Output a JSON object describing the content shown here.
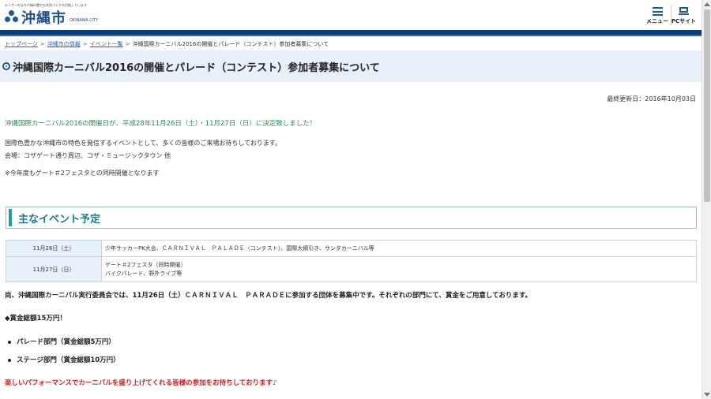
{
  "header": {
    "tagline": "エイサーのまちや緑の豊かな共同づくりを目指しています",
    "logo_name": "沖縄市",
    "logo_en": "OKINAWA CITY",
    "menu_label": "メニュー",
    "pc_label": "PCサイト"
  },
  "breadcrumb": {
    "items": [
      "トップページ",
      "沖縄市の情報",
      "イベント一覧"
    ],
    "current": "沖縄国際カーニバル2016の開催とパレード（コンテスト）参加者募集について",
    "separator": ">"
  },
  "page": {
    "title": "沖縄国際カーニバル2016の開催とパレード（コンテスト）参加者募集について",
    "updated": "最終更新日：2016年10月03日",
    "lead": "沖縄国際カーニバル2016の開催日が、平成28年11月26日（土）・11月27日（日）に決定致しました！",
    "para1": "国際色豊かな沖縄市の特色を発信するイベントとして、多くの皆様のご来場お待ちしております。",
    "para2": "会場：コザゲート通り周辺、コザ・ミュージックタウン 他",
    "note": "※今年度もゲート＃2フェスタとの同時開催となります"
  },
  "section": {
    "heading": "主なイベント予定"
  },
  "events": [
    {
      "date": "11月26日（土）",
      "lines": [
        "少年サッカーPK大会、ＣＡＲＮＩＶＡＬ　ＰＡＬＡＤＥ（コンテスト）、国際大綱引き、サンタカーニバル等"
      ]
    },
    {
      "date": "11月27日（日）",
      "lines": [
        "ゲート＃2フェスタ（同時開催）",
        "バイクパレード、野外ライブ等"
      ]
    }
  ],
  "body": {
    "recruit": "尚、沖縄国際カーニバル実行委員会では、11月26日（土）ＣＡＲＮＩＶＡＬ　ＰＡＲＡＤＥに参加する団体を募集中です。それぞれの部門にて、賞金をご用意しております。",
    "prize_total": "◆賞金総額15万円！",
    "prize_items": [
      "パレード部門（賞金総額5万円）",
      "ステージ部門（賞金総額10万円）"
    ],
    "closing": "楽しいパフォーマンスでカーニバルを盛り上げてくれる皆様の参加をお待ちしております♪"
  },
  "colors": {
    "brand": "#1d4f8c",
    "nav": "#0d3c78",
    "lead_green": "#2e8a57",
    "closing_red": "#d21f1f",
    "heading_teal": "#1b7c8a"
  }
}
